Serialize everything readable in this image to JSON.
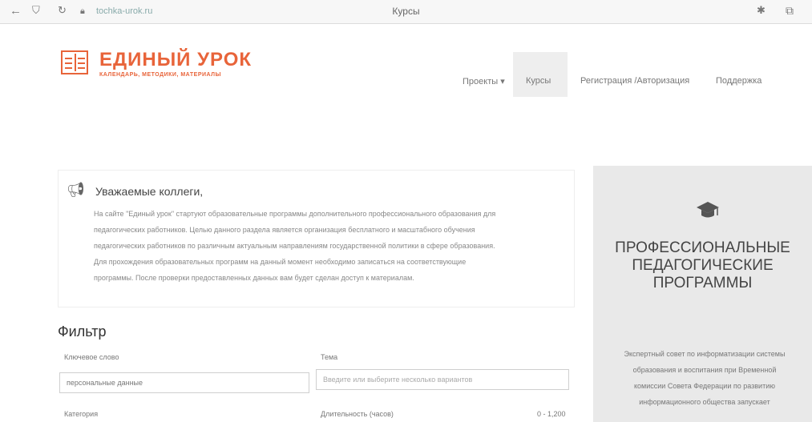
{
  "browser": {
    "back": "←",
    "url": "tochka-urok.ru",
    "title": "Курсы",
    "icons": [
      "arrow-back-icon",
      "shield-icon",
      "reload-icon",
      "lock-icon",
      "star-icon",
      "extensions-icon"
    ]
  },
  "header": {
    "logo_title": "ЕДИНЫЙ УРОК",
    "logo_subtitle": "КАЛЕНДАРЬ, МЕТОДИКИ, МАТЕРИАЛЫ",
    "menu": [
      {
        "label": "Проекты ▾"
      },
      {
        "label": "Курсы"
      },
      {
        "label": "Регистрация /Авторизация"
      },
      {
        "label": "Поддержка"
      }
    ]
  },
  "notice": {
    "heading": "Уважаемые коллеги,",
    "lines": [
      "На сайте \"Единый урок\" стартуют образовательные программы дополнительного профессионального образования для",
      "педагогических работников. Целью данного раздела является организация бесплатного и масштабного обучения",
      "педагогических работников по различным актуальным направлениям государственной политики в сфере образования.",
      "Для прохождения образовательных программ на данный момент необходимо записаться на соответствующие",
      "программы. После проверки предоставленных данных вам будет сделан доступ к материалам."
    ]
  },
  "filter": {
    "title": "Фильтр",
    "keyword_label": "Ключевое слово",
    "keyword_value": "персональные данные",
    "topic_label": "Тема",
    "topic_placeholder": "Введите или выберите несколько вариантов",
    "category_label": "Категория",
    "duration_label": "Длительность (часов)",
    "duration_range": "0 - 1,200"
  },
  "panel": {
    "title_lines": [
      "ПРОФЕССИОНАЛЬНЫЕ",
      "ПЕДАГОГИЧЕСКИЕ",
      "ПРОГРАММЫ"
    ],
    "text_lines": [
      "Экспертный совет по информатизации системы",
      "образования и воспитания при Временной",
      "комиссии Совета Федерации по развитию",
      "информационного общества запускает"
    ]
  }
}
